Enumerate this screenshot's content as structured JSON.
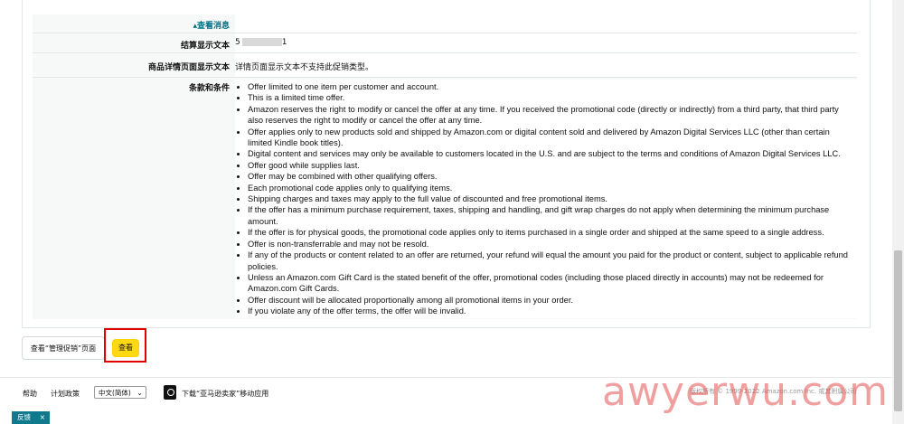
{
  "details": {
    "view_message_link": "▴查看消息",
    "checkout_label": "结算显示文本",
    "checkout_value_prefix": "5",
    "checkout_value_suffix": "1",
    "detail_page_label": "商品详情页面显示文本",
    "detail_page_value": "详情页面显示文本不支持此促销类型。",
    "terms_label": "条款和条件",
    "terms": [
      "Offer limited to one item per customer and account.",
      "This is a limited time offer.",
      "Amazon reserves the right to modify or cancel the offer at any time. If you received the promotional code (directly or indirectly) from a third party, that third party also reserves the right to modify or cancel the offer at any time.",
      "Offer applies only to new products sold and shipped by Amazon.com or digital content sold and delivered by Amazon Digital Services LLC (other than certain limited Kindle book titles).",
      "Digital content and services may only be available to customers located in the U.S. and are subject to the terms and conditions of Amazon Digital Services LLC.",
      "Offer good while supplies last.",
      "Offer may be combined with other qualifying offers.",
      "Each promotional code applies only to qualifying items.",
      "Shipping charges and taxes may apply to the full value of discounted and free promotional items.",
      "If the offer has a minimum purchase requirement, taxes, shipping and handling, and gift wrap charges do not apply when determining the minimum purchase amount.",
      "If the offer is for physical goods, the promotional code applies only to items purchased in a single order and shipped at the same speed to a single address.",
      "Offer is non-transferrable and may not be resold.",
      "If any of the products or content related to an offer are returned, your refund will equal the amount you paid for the product or content, subject to applicable refund policies.",
      "Unless an Amazon.com Gift Card is the stated benefit of the offer, promotional codes (including those placed directly in accounts) may not be redeemed for Amazon.com Gift Cards.",
      "Offer discount will be allocated proportionally among all promotional items in your order.",
      "If you violate any of the offer terms, the offer will be invalid."
    ]
  },
  "actions": {
    "view_manage_label": "查看“管理促销”页面",
    "view_label": "查看"
  },
  "footer": {
    "help": "帮助",
    "program_policies": "计划政策",
    "language": "中文(简体)",
    "download_app": "下载“亚马逊卖家”移动应用",
    "copyright": "版权所有 © 1999-2022 Amazon.com Inc. 或其附属公司",
    "feedback": "反馈",
    "close": "×"
  },
  "watermark": "awyerwu.com"
}
